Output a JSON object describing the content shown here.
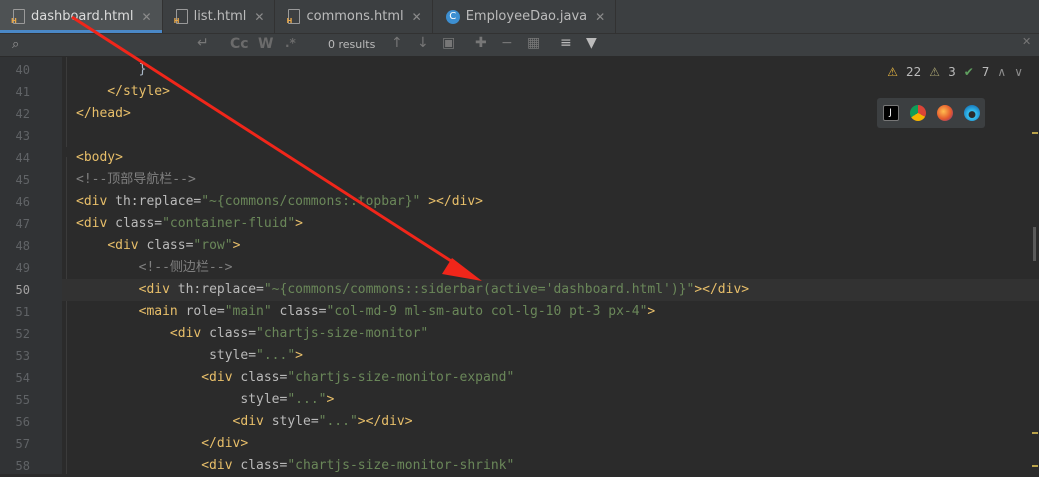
{
  "tabs": [
    {
      "label": "dashboard.html",
      "type": "html",
      "active": true
    },
    {
      "label": "list.html",
      "type": "html",
      "active": false
    },
    {
      "label": "commons.html",
      "type": "html",
      "active": false
    },
    {
      "label": "EmployeeDao.java",
      "type": "java",
      "active": false
    }
  ],
  "find": {
    "results": "0 results",
    "cc": "Cc",
    "w": "W",
    "regex": ".*"
  },
  "inspection": {
    "warnings": "22",
    "weak_warnings": "3",
    "ok": "7"
  },
  "lines": [
    {
      "n": "40",
      "code": [
        {
          "c": "p",
          "t": "        }"
        }
      ]
    },
    {
      "n": "41",
      "code": [
        {
          "c": "t",
          "t": "    </style>"
        }
      ]
    },
    {
      "n": "42",
      "code": [
        {
          "c": "t",
          "t": "</head>"
        }
      ]
    },
    {
      "n": "43",
      "code": []
    },
    {
      "n": "44",
      "code": [
        {
          "c": "t",
          "t": "<body>"
        }
      ]
    },
    {
      "n": "45",
      "code": [
        {
          "c": "c",
          "t": "<!--顶部导航栏-->"
        }
      ]
    },
    {
      "n": "46",
      "code": [
        {
          "c": "t",
          "t": "<div "
        },
        {
          "c": "a",
          "t": "th:replace="
        },
        {
          "c": "s",
          "t": "\"~{commons/commons::topbar}\""
        },
        {
          "c": "t",
          "t": " ></div>"
        }
      ]
    },
    {
      "n": "47",
      "code": [
        {
          "c": "t",
          "t": "<div "
        },
        {
          "c": "a",
          "t": "class="
        },
        {
          "c": "s",
          "t": "\"container-fluid\""
        },
        {
          "c": "t",
          "t": ">"
        }
      ]
    },
    {
      "n": "48",
      "code": [
        {
          "c": "p",
          "t": "    "
        },
        {
          "c": "t",
          "t": "<div "
        },
        {
          "c": "a",
          "t": "class="
        },
        {
          "c": "s",
          "t": "\"row\""
        },
        {
          "c": "t",
          "t": ">"
        }
      ]
    },
    {
      "n": "49",
      "code": [
        {
          "c": "p",
          "t": "        "
        },
        {
          "c": "c",
          "t": "<!--侧边栏-->"
        }
      ]
    },
    {
      "n": "50",
      "code": [
        {
          "c": "p",
          "t": "        "
        },
        {
          "c": "t",
          "t": "<div "
        },
        {
          "c": "a",
          "t": "th:replace="
        },
        {
          "c": "s",
          "t": "\"~{commons/commons::siderbar(active='dashboard.html')}\""
        },
        {
          "c": "t",
          "t": "></div>"
        }
      ]
    },
    {
      "n": "51",
      "code": [
        {
          "c": "p",
          "t": "        "
        },
        {
          "c": "t",
          "t": "<main "
        },
        {
          "c": "a",
          "t": "role="
        },
        {
          "c": "s",
          "t": "\"main\""
        },
        {
          "c": "a",
          "t": " class="
        },
        {
          "c": "s",
          "t": "\"col-md-9 ml-sm-auto col-lg-10 pt-3 px-4\""
        },
        {
          "c": "t",
          "t": ">"
        }
      ]
    },
    {
      "n": "52",
      "code": [
        {
          "c": "p",
          "t": "            "
        },
        {
          "c": "t",
          "t": "<div "
        },
        {
          "c": "a",
          "t": "class="
        },
        {
          "c": "s",
          "t": "\"chartjs-size-monitor\""
        }
      ]
    },
    {
      "n": "53",
      "code": [
        {
          "c": "p",
          "t": "                 "
        },
        {
          "c": "a",
          "t": "style="
        },
        {
          "c": "s",
          "t": "\"...\""
        },
        {
          "c": "t",
          "t": ">"
        }
      ]
    },
    {
      "n": "54",
      "code": [
        {
          "c": "p",
          "t": "                "
        },
        {
          "c": "t",
          "t": "<div "
        },
        {
          "c": "a",
          "t": "class="
        },
        {
          "c": "s",
          "t": "\"chartjs-size-monitor-expand\""
        }
      ]
    },
    {
      "n": "55",
      "code": [
        {
          "c": "p",
          "t": "                     "
        },
        {
          "c": "a",
          "t": "style="
        },
        {
          "c": "s",
          "t": "\"...\""
        },
        {
          "c": "t",
          "t": ">"
        }
      ]
    },
    {
      "n": "56",
      "code": [
        {
          "c": "p",
          "t": "                    "
        },
        {
          "c": "t",
          "t": "<div "
        },
        {
          "c": "a",
          "t": "style="
        },
        {
          "c": "s",
          "t": "\"...\""
        },
        {
          "c": "t",
          "t": "></div>"
        }
      ]
    },
    {
      "n": "57",
      "code": [
        {
          "c": "p",
          "t": "                "
        },
        {
          "c": "t",
          "t": "</div>"
        }
      ]
    },
    {
      "n": "58",
      "code": [
        {
          "c": "p",
          "t": "                "
        },
        {
          "c": "t",
          "t": "<div "
        },
        {
          "c": "a",
          "t": "class="
        },
        {
          "c": "s",
          "t": "\"chartjs-size-monitor-shrink\""
        }
      ]
    }
  ],
  "current_line": "50",
  "colors": {
    "tag": "#e8bf6a",
    "attr": "#bababa",
    "string": "#6a8759",
    "comment": "#808080",
    "arrow": "#f0261a",
    "accent": "#4a88c7"
  }
}
